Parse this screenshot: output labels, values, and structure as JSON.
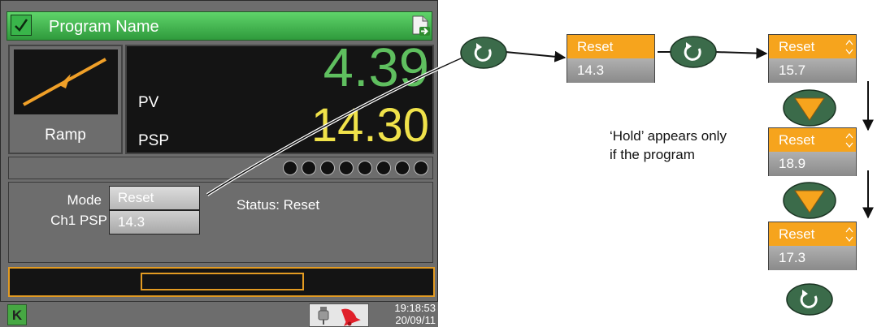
{
  "panel": {
    "title": "Program Name",
    "segment_type": "Ramp",
    "pv_label": "PV",
    "pv_value": "4.39",
    "psp_label": "PSP",
    "psp_value": "14.30",
    "mode_label": "Mode",
    "mode_value": "Reset",
    "ch1_label": "Ch1 PSP",
    "ch1_value": "14.3",
    "status": "Status: Reset",
    "logo": "K",
    "time": "19:18:53",
    "date": "20/09/11",
    "icons": [
      "check-icon",
      "document-export-icon",
      "usb-icon",
      "alarm-bell-icon"
    ],
    "colors": {
      "title_green": "#39b54a",
      "pv_green": "#5fbf5f",
      "psp_yellow": "#f0e24a",
      "accent_orange": "#f6a41d"
    }
  },
  "sequence": {
    "box1": {
      "mode": "Reset",
      "value": "14.3"
    },
    "box2": {
      "mode": "Reset",
      "value": "15.7"
    },
    "box3": {
      "mode": "Reset",
      "value": "18.9"
    },
    "box4": {
      "mode": "Reset",
      "value": "17.3"
    }
  },
  "note": {
    "line1": "‘Hold’ appears only",
    "line2": "if the program"
  }
}
